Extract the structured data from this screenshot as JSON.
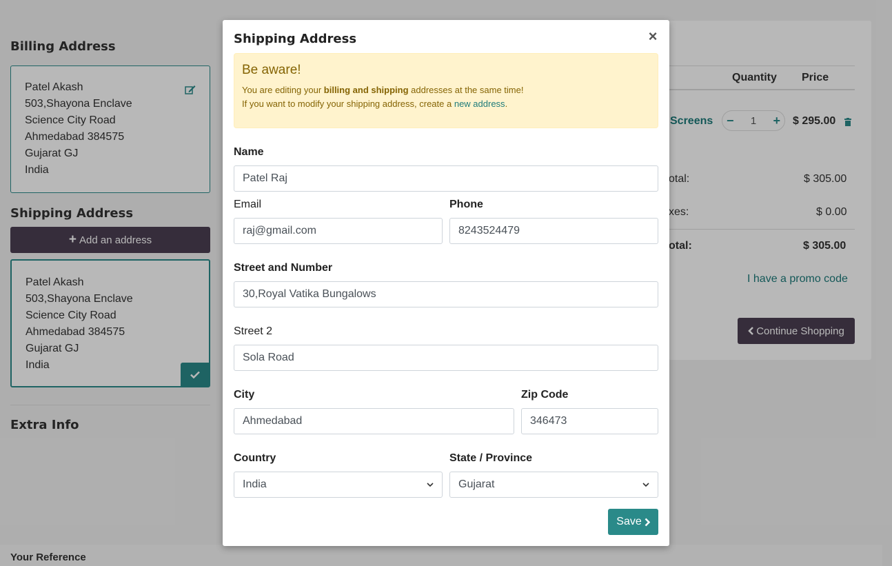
{
  "billing": {
    "title": "Billing Address",
    "lines": [
      "Patel Akash",
      "503,Shayona Enclave",
      "Science City Road",
      "Ahmedabad 384575",
      "Gujarat GJ",
      "India"
    ]
  },
  "shipping": {
    "title": "Shipping Address",
    "add_button": "Add an address",
    "lines": [
      "Patel Akash",
      "503,Shayona Enclave",
      "Science City Road",
      "Ahmedabad 384575",
      "Gujarat GJ",
      "India"
    ]
  },
  "extra_info": "Extra Info",
  "your_reference": "Your Reference",
  "cart": {
    "col_quantity": "Quantity",
    "col_price": "Price",
    "product_partial": "Screens",
    "quantity": "1",
    "minus": "−",
    "plus": "+",
    "line_price": "$ 295.00",
    "subtotal_label_partial": "otal:",
    "subtotal_value": "$ 305.00",
    "taxes_label_partial": "xes:",
    "taxes_value": "$ 0.00",
    "total_label_partial": "otal:",
    "total_value": "$ 305.00",
    "promo_link": "I have a promo code",
    "continue_button": "Continue Shopping"
  },
  "modal": {
    "title": "Shipping Address",
    "close": "×",
    "alert": {
      "title": "Be aware!",
      "line1_pre": "You are editing your ",
      "line1_bold": "billing and shipping",
      "line1_post": " addresses at the same time!",
      "line2_pre": "If you want to modify your shipping address, create a ",
      "line2_link": "new address",
      "line2_post": "."
    },
    "fields": {
      "name_label": "Name",
      "name_value": "Patel Raj",
      "email_label": "Email",
      "email_value": "raj@gmail.com",
      "phone_label": "Phone",
      "phone_value": "8243524479",
      "street_label": "Street and Number",
      "street_value": "30,Royal Vatika Bungalows",
      "street2_label": "Street 2",
      "street2_value": "Sola Road",
      "city_label": "City",
      "city_value": "Ahmedabad",
      "zip_label": "Zip Code",
      "zip_value": "346473",
      "country_label": "Country",
      "country_value": "India",
      "state_label": "State / Province",
      "state_value": "Gujarat"
    },
    "save_button": "Save"
  },
  "colors": {
    "accent": "#2a8a89",
    "dark_button": "#4b3f53",
    "alert_bg": "#fff3cd",
    "alert_text": "#856404"
  }
}
